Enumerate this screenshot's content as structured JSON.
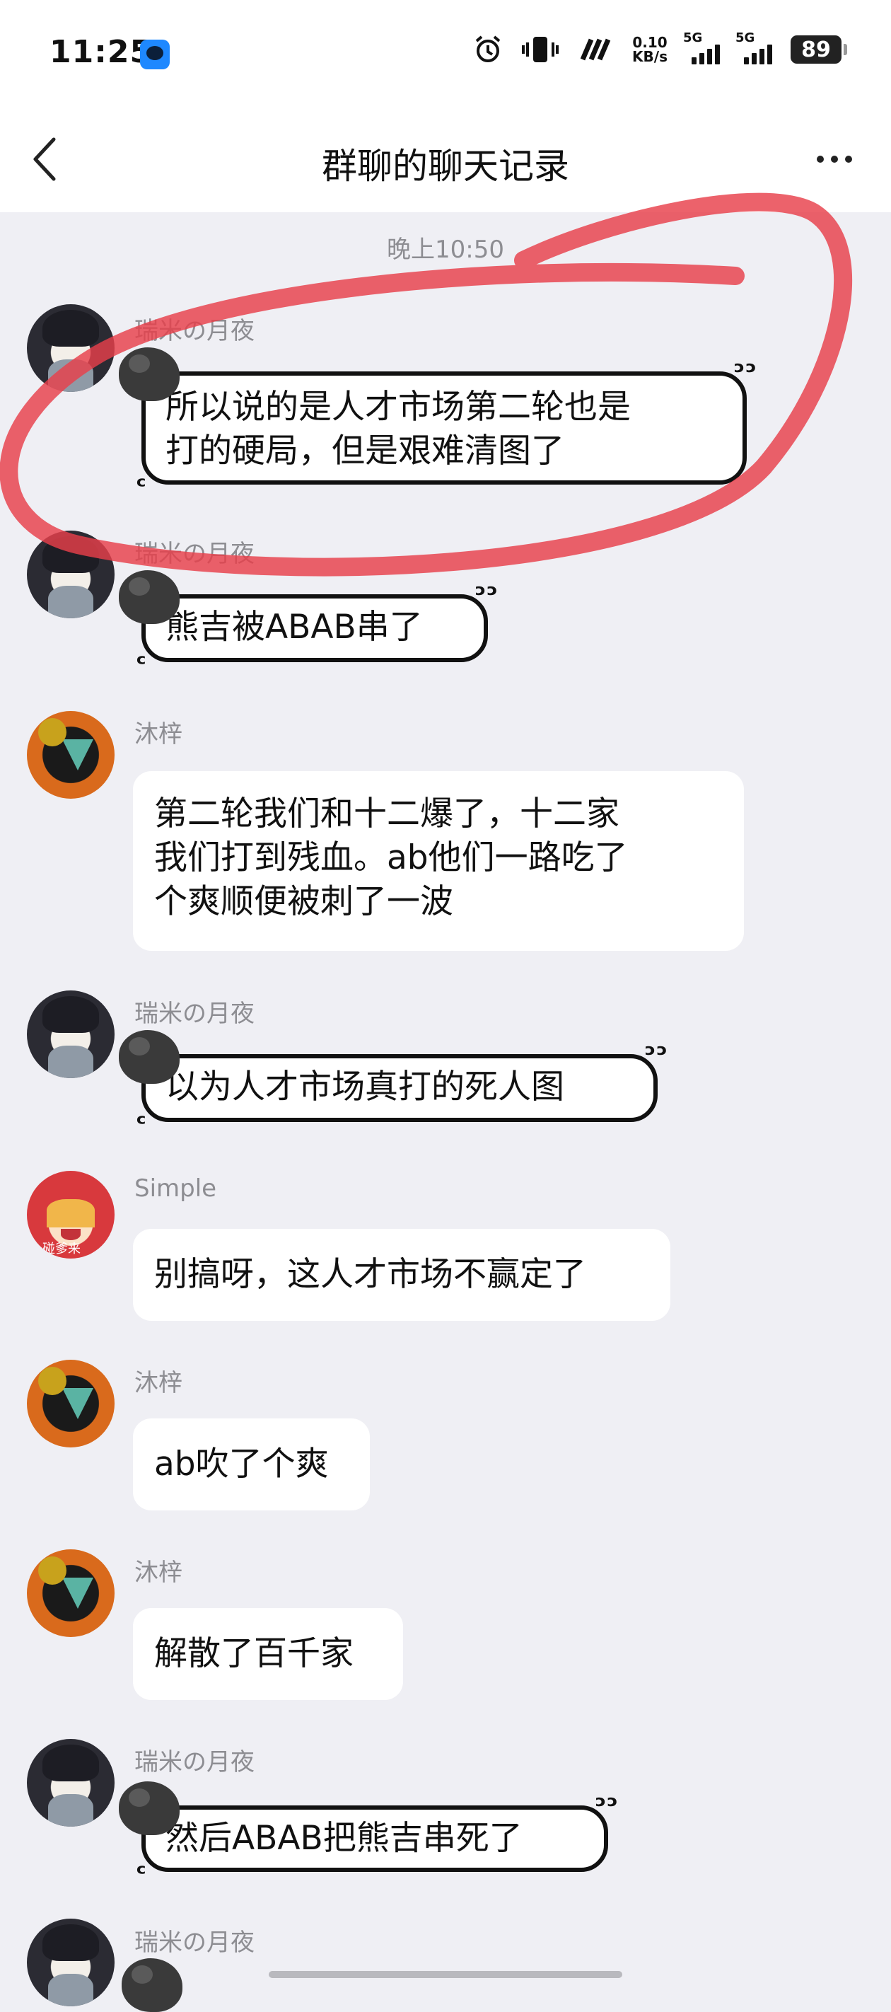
{
  "status_bar": {
    "time": "11:25",
    "net_speed_value": "0.10",
    "net_speed_unit": "KB/s",
    "sim1_label": "5G",
    "sim2_label": "5G",
    "battery": "89",
    "icons": [
      "app-notification-icon",
      "alarm-icon",
      "vibrate-icon",
      "nfc-icon",
      "signal-icon",
      "battery-icon"
    ]
  },
  "nav": {
    "title": "群聊的聊天记录"
  },
  "timestamp": "晚上10:50",
  "messages": [
    {
      "sender": "瑞米の月夜",
      "text_lines": [
        "所以说的是人才市场第二轮也是",
        "打的硬局，但是艰难清图了"
      ],
      "style": "decorated"
    },
    {
      "sender": "瑞米の月夜",
      "text_lines": [
        "熊吉被ABAB串了"
      ],
      "style": "decorated"
    },
    {
      "sender": "沐梓",
      "text_lines": [
        "第二轮我们和十二爆了，十二家",
        "我们打到残血。ab他们一路吃了",
        "个爽顺便被刺了一波"
      ],
      "style": "plain"
    },
    {
      "sender": "瑞米の月夜",
      "text_lines": [
        "以为人才市场真打的死人图"
      ],
      "style": "decorated"
    },
    {
      "sender": "Simple",
      "text_lines": [
        "别搞呀，这人才市场不赢定了"
      ],
      "style": "plain",
      "avatar_text": "碰爹来"
    },
    {
      "sender": "沐梓",
      "text_lines": [
        "ab吹了个爽"
      ],
      "style": "plain"
    },
    {
      "sender": "沐梓",
      "text_lines": [
        "解散了百千家"
      ],
      "style": "plain"
    },
    {
      "sender": "瑞米の月夜",
      "text_lines": [
        "然后ABAB把熊吉串死了"
      ],
      "style": "decorated"
    },
    {
      "sender": "瑞米の月夜",
      "text_lines": [],
      "style": "decorated"
    }
  ],
  "colors": {
    "background": "#efeff4",
    "bubble": "#ffffff",
    "annotation_red": "#e8404a",
    "meta_text": "#8d8d92"
  }
}
